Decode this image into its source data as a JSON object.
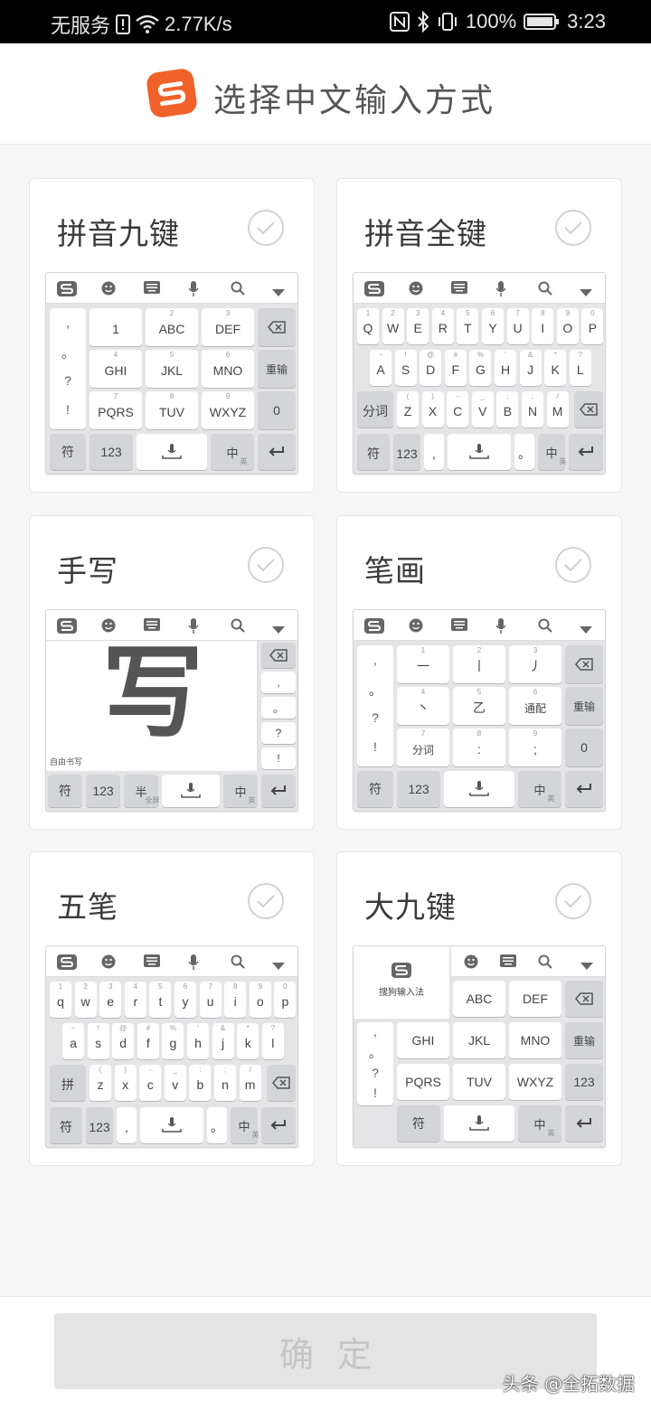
{
  "status_bar": {
    "carrier": "无服务",
    "speed": "2.77K/s",
    "battery": "100%",
    "time": "3:23"
  },
  "header": {
    "title": "选择中文输入方式"
  },
  "cards": [
    {
      "title": "拼音九键"
    },
    {
      "title": "拼音全键"
    },
    {
      "title": "手写"
    },
    {
      "title": "笔画"
    },
    {
      "title": "五笔"
    },
    {
      "title": "大九键"
    }
  ],
  "keyboards": {
    "nine": {
      "side": [
        ",",
        "。",
        "?",
        "!"
      ],
      "keys": [
        "1",
        "ABC",
        "DEF",
        "GHI",
        "JKL",
        "MNO",
        "PQRS",
        "TUV",
        "WXYZ"
      ],
      "subs": [
        "",
        "2",
        "3",
        "4",
        "5",
        "6",
        "7",
        "8",
        "9"
      ],
      "chongshu": "重输",
      "zero": "0",
      "fu": "符",
      "num": "123",
      "zh": "中",
      "en": "英"
    },
    "full": {
      "row1": [
        "Q",
        "W",
        "E",
        "R",
        "T",
        "Y",
        "U",
        "I",
        "O",
        "P"
      ],
      "row1_sub": [
        "1",
        "2",
        "3",
        "4",
        "5",
        "6",
        "7",
        "8",
        "9",
        "0"
      ],
      "row2": [
        "A",
        "S",
        "D",
        "F",
        "G",
        "H",
        "J",
        "K",
        "L"
      ],
      "row2_sub": [
        "~",
        "!",
        "@",
        "#",
        "%",
        "'",
        "&",
        "*",
        "?"
      ],
      "row3": [
        "Z",
        "X",
        "C",
        "V",
        "B",
        "N",
        "M"
      ],
      "row3_sub": [
        "(",
        ")",
        "-",
        "_",
        ":",
        ";",
        "/"
      ],
      "fenci": "分词",
      "fu": "符",
      "num": "123",
      "comma": ",",
      "period": "。",
      "zh": "中",
      "en": "英"
    },
    "handwrite": {
      "glyph": "写",
      "free_label": "自由书写",
      "side": [
        ",",
        "。",
        "?",
        "!"
      ],
      "fu": "符",
      "num": "123",
      "half": "半",
      "full_width": "全屏",
      "zh": "中",
      "en": "英"
    },
    "stroke": {
      "side": [
        ",",
        "。",
        "?",
        "!"
      ],
      "keys": [
        "一",
        "丨",
        "丿",
        "丶",
        "乙",
        "通配",
        "分词",
        ":",
        ";"
      ],
      "subs": [
        "1",
        "2",
        "3",
        "4",
        "5",
        "6",
        "7",
        "8",
        "9"
      ],
      "chongshu": "重输",
      "zero": "0",
      "fu": "符",
      "num": "123",
      "zh": "中",
      "en": "英"
    },
    "wubi": {
      "row1": [
        "q",
        "w",
        "e",
        "r",
        "t",
        "y",
        "u",
        "i",
        "o",
        "p"
      ],
      "row1_sub": [
        "1",
        "2",
        "3",
        "4",
        "5",
        "6",
        "7",
        "8",
        "9",
        "0"
      ],
      "row2": [
        "a",
        "s",
        "d",
        "f",
        "g",
        "h",
        "j",
        "k",
        "l"
      ],
      "row2_sub": [
        "~",
        "!",
        "@",
        "#",
        "%",
        "'",
        "&",
        "*",
        "?"
      ],
      "row3": [
        "z",
        "x",
        "c",
        "v",
        "b",
        "n",
        "m"
      ],
      "row3_sub": [
        "(",
        ")",
        "-",
        "_",
        ":",
        ";",
        "/"
      ],
      "pin": "拼",
      "fu": "符",
      "num": "123",
      "comma": ",",
      "period": "。",
      "zh": "中",
      "en": "英"
    },
    "big_nine": {
      "brand": "搜狗输入法",
      "side": [
        ",",
        "。",
        "?",
        "!"
      ],
      "keys": [
        "ABC",
        "DEF",
        "GHI",
        "JKL",
        "MNO",
        "PQRS",
        "TUV",
        "WXYZ"
      ],
      "chongshu": "重输",
      "num": "123",
      "fu": "符",
      "zh": "中",
      "en": "英"
    }
  },
  "confirm_label": "确定",
  "watermark": "头条 @全拓数据",
  "colors": {
    "brand": "#f0622a",
    "status_bg": "#000000"
  }
}
